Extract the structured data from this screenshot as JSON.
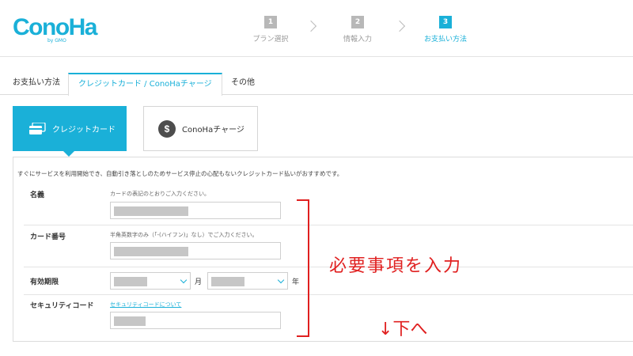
{
  "header": {
    "logo": {
      "main": "ConoHa",
      "sub": "by GMO"
    },
    "steps": [
      {
        "num": "1",
        "label": "プラン選択"
      },
      {
        "num": "2",
        "label": "情報入力"
      },
      {
        "num": "3",
        "label": "お支払い方法"
      }
    ]
  },
  "tabs": [
    {
      "label": "お支払い方法"
    },
    {
      "label": "クレジットカード / ConoHaチャージ"
    },
    {
      "label": "その他"
    }
  ],
  "methods": {
    "credit": {
      "label": "クレジットカード"
    },
    "charge": {
      "label": "ConoHaチャージ",
      "icon_glyph": "$"
    }
  },
  "form": {
    "intro": "すぐにサービスを利用開始でき、自動引き落としのためサービス停止の心配もないクレジットカード払いがおすすめです。",
    "name": {
      "label": "名義",
      "hint": "カードの表記のとおりご入力ください。"
    },
    "card_number": {
      "label": "カード番号",
      "hint": "半角英数字のみ（「-(ハイフン)」なし）でご入力ください。"
    },
    "expiry": {
      "label": "有効期限",
      "month_unit": "月",
      "year_unit": "年"
    },
    "security": {
      "label": "セキュリティコード",
      "link": "セキュリティコードについて"
    }
  },
  "annotations": {
    "main": "必要事項を入力",
    "down": "↓下へ"
  },
  "colors": {
    "accent": "#1ab0d8",
    "annotation": "#e02020"
  }
}
